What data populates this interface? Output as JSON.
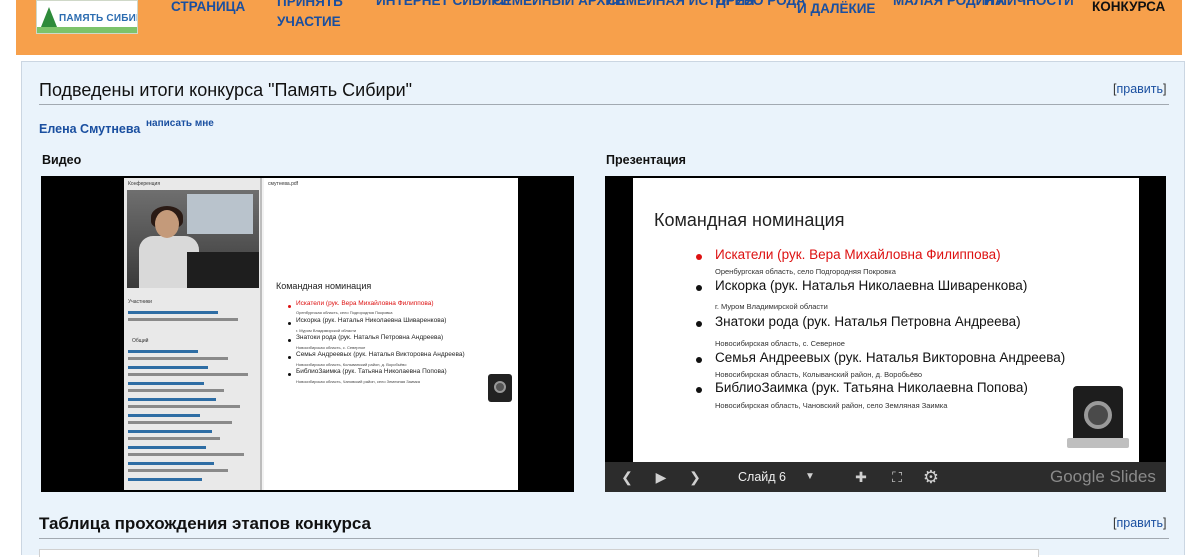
{
  "logo": {
    "text": "ПАМЯТЬ СИБИРИ"
  },
  "nav": {
    "items": [
      {
        "label": "СТРАНИЦА"
      },
      {
        "label": "ПРИНЯТЬ УЧАСТИЕ"
      },
      {
        "label": "ИНТЕРНЕТ СИБИРИ"
      },
      {
        "label": "СЕМЕЙНЫЙ АРХИВ"
      },
      {
        "label": "СЕМЕЙНАЯ ИСТОРИЯ"
      },
      {
        "label": "ДРЕВО РОДА"
      },
      {
        "label": "И ДАЛЁКИЕ"
      },
      {
        "label": "МАЛАЯ РОДИНА"
      },
      {
        "label": "И ЛИЧНОСТИ"
      },
      {
        "label": "КОНКУРСА"
      }
    ]
  },
  "page": {
    "title": "Подведены итоги конкурса \"Память Сибири\"",
    "edit_label": "править",
    "author": "Елена Смутнева",
    "write_me": "написать мне",
    "video_label": "Видео",
    "presentation_label": "Презентация",
    "section2_title": "Таблица прохождения этапов конкурса"
  },
  "video": {
    "conference_label": "Конференция",
    "file_label": "смутнева.pdf",
    "participants_label": "Участники",
    "chat_label": "Общий"
  },
  "slide": {
    "title": "Командная номинация",
    "items": [
      {
        "text": "Искатели (рук. Вера Михайловна Филиппова)",
        "sub": "Оренбургская область, село Подгородняя Покровка",
        "highlight": true
      },
      {
        "text": "Искорка (рук. Наталья Николаевна Шиваренкова)",
        "sub": "г. Муром Владимирской области",
        "highlight": false
      },
      {
        "text": "Знатоки рода (рук. Наталья Петровна Андреева)",
        "sub": "Новосибирская область, с. Северное",
        "highlight": false
      },
      {
        "text": "Семья Андреевых (рук. Наталья Викторовна Андреева)",
        "sub": "Новосибирская область, Колыванский район, д. Воробьёво",
        "highlight": false
      },
      {
        "text": "БиблиоЗаимка (рук. Татьяна Николаевна Попова)",
        "sub": "Новосибирская область, Чановский район, село Земляная Заимка",
        "highlight": false
      }
    ]
  },
  "slides_controls": {
    "slide_counter": "Слайд 6",
    "brand": "Google Slides"
  },
  "colors": {
    "topbar": "#f7a04b",
    "nav_link": "#1a4fa0",
    "content_bg": "#eaf3fb",
    "highlight_red": "#dd1111"
  }
}
